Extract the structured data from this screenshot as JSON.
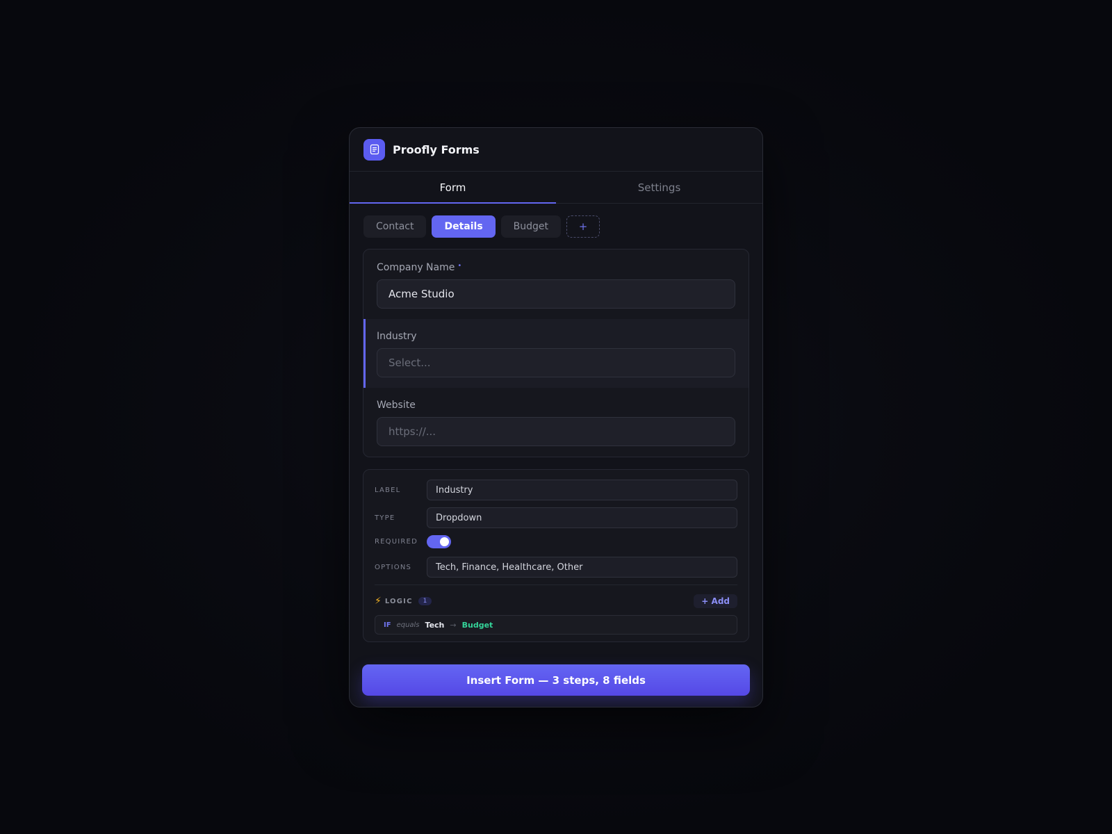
{
  "app": {
    "title": "Proofly Forms",
    "logo_icon": "form-document-icon",
    "accent_color": "#6366f1"
  },
  "tabs": [
    {
      "label": "Form",
      "active": true
    },
    {
      "label": "Settings",
      "active": false
    }
  ],
  "steps": [
    {
      "label": "Contact",
      "active": false
    },
    {
      "label": "Details",
      "active": true
    },
    {
      "label": "Budget",
      "active": false
    }
  ],
  "add_step_label": "+",
  "fields": [
    {
      "label": "Company Name",
      "required_mark": "•",
      "value": "Acme Studio",
      "placeholder": ""
    },
    {
      "label": "Industry",
      "value": "",
      "placeholder": "Select..."
    },
    {
      "label": "Website",
      "value": "",
      "placeholder": "https://..."
    }
  ],
  "properties": {
    "label_key": "LABEL",
    "label_value": "Industry",
    "type_key": "TYPE",
    "type_value": "Dropdown",
    "required_key": "REQUIRED",
    "required_on": true,
    "options_key": "OPTIONS",
    "options_value": "Tech, Finance, Healthcare, Other"
  },
  "logic": {
    "icon": "⚡",
    "title": "LOGIC",
    "count": "1",
    "add_label": "+ Add",
    "rule": {
      "if": "IF",
      "operator": "equals",
      "value": "Tech",
      "arrow": "→",
      "target": "Budget"
    }
  },
  "submit_label": "Insert Form — 3 steps, 8 fields"
}
